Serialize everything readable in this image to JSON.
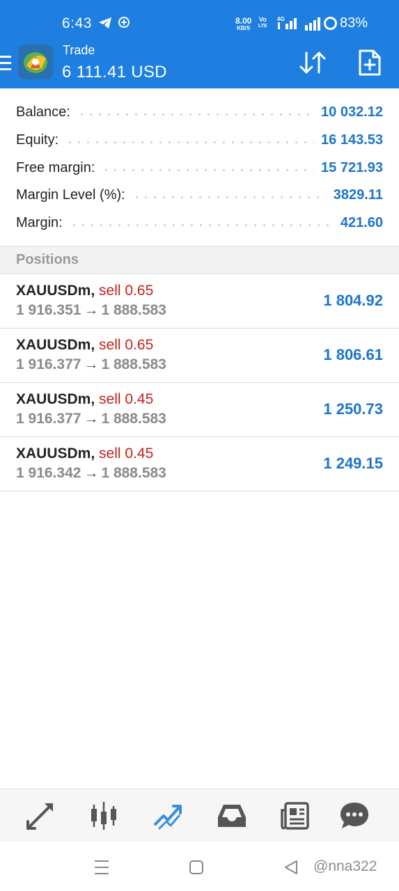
{
  "status_bar": {
    "time": "6:43",
    "net_speed_value": "8.00",
    "net_speed_unit": "KB/S",
    "volte_top": "Vo",
    "volte_bottom": "LTE",
    "network_type": "4G",
    "battery": "83%",
    "icons": [
      "telegram-icon",
      "location-icon",
      "signal-icon",
      "battery-icon"
    ]
  },
  "app_bar": {
    "title": "Trade",
    "balance": "6 111.41 USD",
    "icons": [
      "menu-icon",
      "metatrader-logo",
      "sort-icon",
      "new-order-icon"
    ]
  },
  "summary": [
    {
      "label": "Balance:",
      "value": "10 032.12"
    },
    {
      "label": "Equity:",
      "value": "16 143.53"
    },
    {
      "label": "Free margin:",
      "value": "15 721.93"
    },
    {
      "label": "Margin Level (%):",
      "value": "3829.11"
    },
    {
      "label": "Margin:",
      "value": "421.60"
    }
  ],
  "positions_header": "Positions",
  "positions": [
    {
      "symbol": "XAUUSDm,",
      "side": "sell 0.65",
      "open_price": "1 916.351",
      "arrow": "→",
      "current_price": "1 888.583",
      "profit": "1 804.92"
    },
    {
      "symbol": "XAUUSDm,",
      "side": "sell 0.65",
      "open_price": "1 916.377",
      "arrow": "→",
      "current_price": "1 888.583",
      "profit": "1 806.61"
    },
    {
      "symbol": "XAUUSDm,",
      "side": "sell 0.45",
      "open_price": "1 916.377",
      "arrow": "→",
      "current_price": "1 888.583",
      "profit": "1 250.73"
    },
    {
      "symbol": "XAUUSDm,",
      "side": "sell 0.45",
      "open_price": "1 916.342",
      "arrow": "→",
      "current_price": "1 888.583",
      "profit": "1 249.15"
    }
  ],
  "tab_bar": {
    "tabs": [
      "quotes-icon",
      "chart-icon",
      "trade-icon",
      "history-icon",
      "news-icon",
      "chat-icon"
    ],
    "active": "trade-icon"
  },
  "system_nav": [
    "recents-icon",
    "home-icon",
    "back-icon"
  ],
  "watermark": "@nna322",
  "colors": {
    "header": "#1e7fe0",
    "value_blue": "#1b75c9",
    "sell_red": "#c4221b",
    "muted": "#8a8a8a",
    "active_tab": "#3a8fd9",
    "tab_icon": "#555555"
  }
}
